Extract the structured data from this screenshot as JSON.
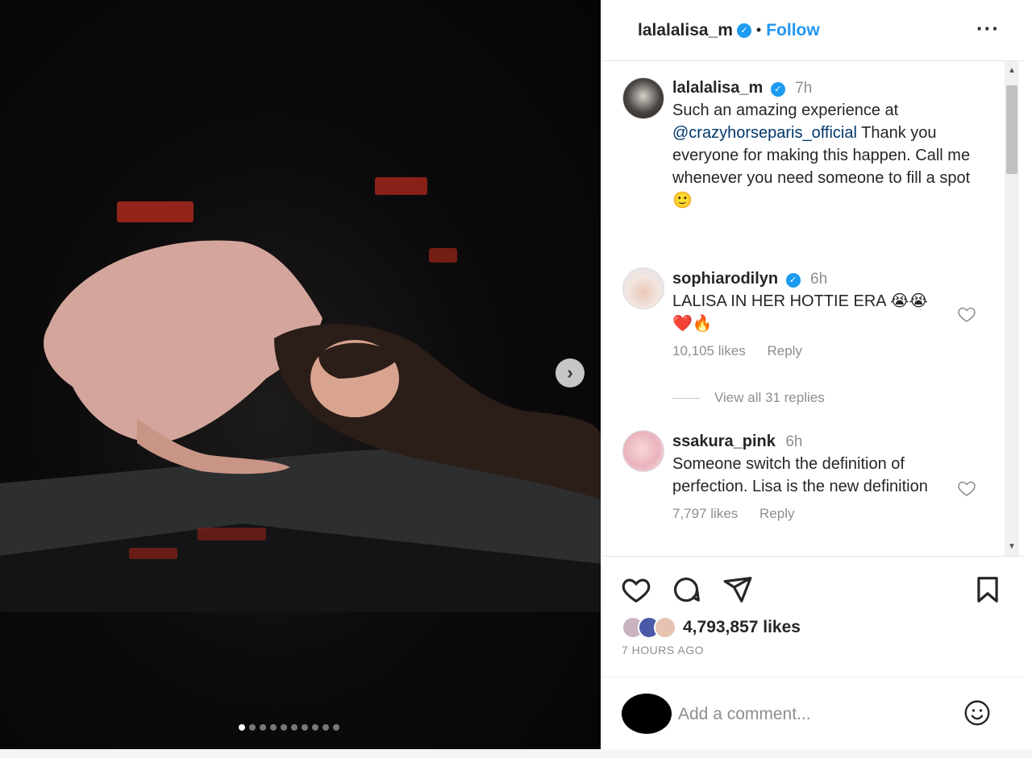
{
  "post": {
    "username": "lalalalisa_m",
    "follow_label": "Follow",
    "more_label": "···",
    "separator": "•",
    "verified_mark": "✓"
  },
  "caption": {
    "username": "lalalalisa_m",
    "time": "7h",
    "text_before": "Such an amazing experience at ",
    "mention": "@crazyhorseparis_official",
    "text_after": " Thank you everyone for making this happen. Call me whenever you need someone to fill a spot🙂"
  },
  "comments": [
    {
      "username": "sophiarodilyn",
      "verified": true,
      "time": "6h",
      "text": "LALISA IN HER HOTTIE ERA 😭😭 ❤️🔥",
      "likes": "10,105 likes",
      "reply_label": "Reply",
      "view_replies": "View all 31 replies"
    },
    {
      "username": "ssakura_pink",
      "verified": false,
      "time": "6h",
      "text": "Someone switch the definition of perfection. Lisa is the new definition",
      "likes": "7,797 likes",
      "reply_label": "Reply"
    }
  ],
  "stats": {
    "likes": "4,793,857 likes",
    "time_ago": "7 HOURS AGO"
  },
  "composer": {
    "placeholder": "Add a comment..."
  },
  "carousel": {
    "next_label": "›",
    "total": 10,
    "current": 1
  },
  "icons": {
    "next": "chevron-right-icon",
    "like": "heart-icon",
    "comment": "comment-bubble-icon",
    "share": "paper-plane-icon",
    "save": "bookmark-icon",
    "emoji": "smiley-icon"
  },
  "colors": {
    "accent": "#1d9bf0",
    "follow": "#2196f3",
    "text": "#262626",
    "muted": "#8e8e8e"
  }
}
